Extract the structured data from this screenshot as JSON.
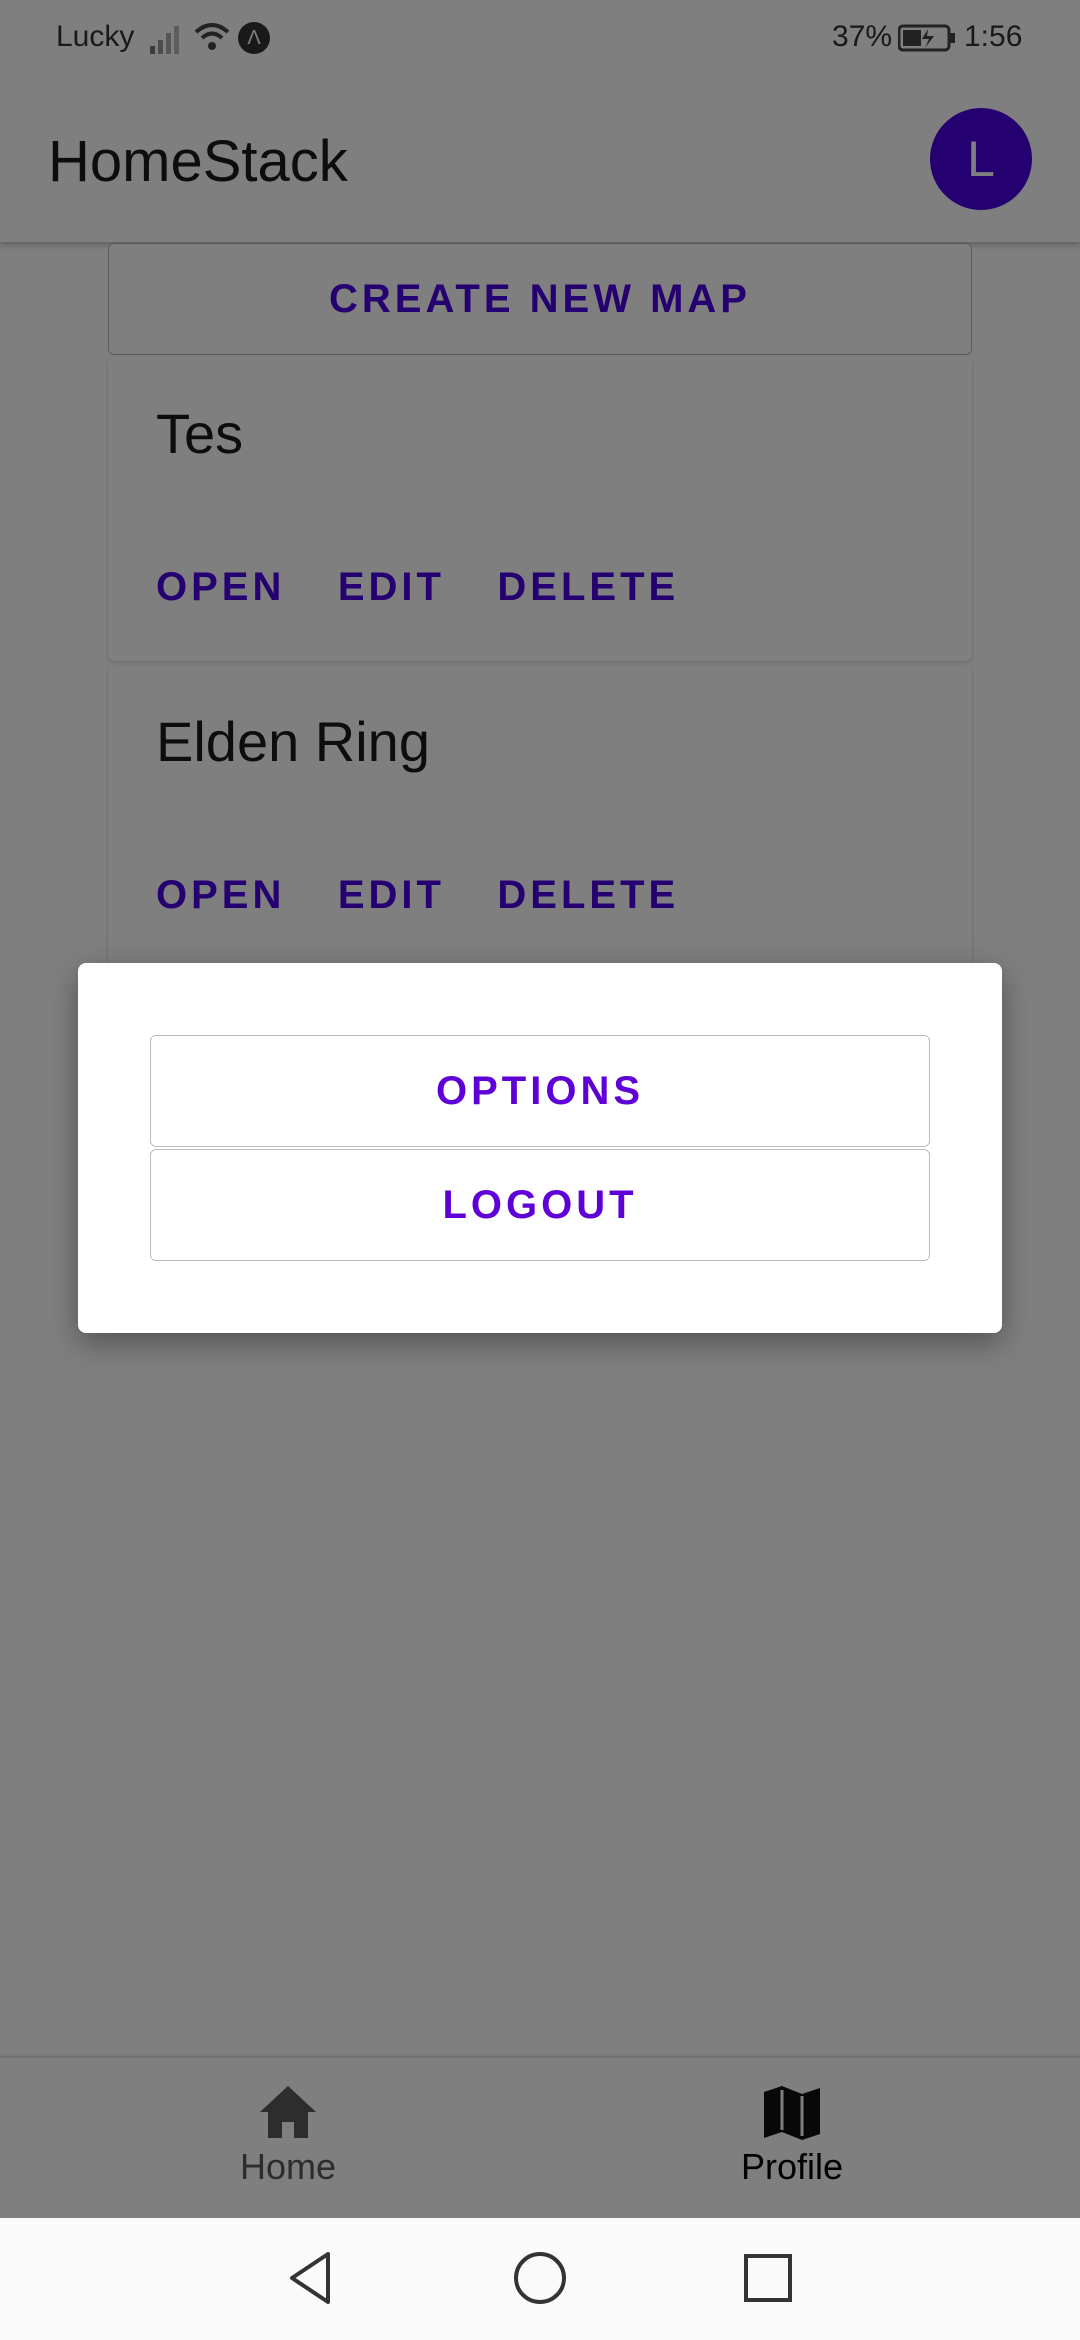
{
  "status_bar": {
    "carrier": "Lucky",
    "battery_percent": "37%",
    "time": "1:56",
    "app_indicator": "Λ"
  },
  "app_bar": {
    "title": "HomeStack",
    "avatar_letter": "L"
  },
  "content": {
    "create_button": "CREATE NEW MAP",
    "maps": [
      {
        "title": "Tes",
        "open": "OPEN",
        "edit": "EDIT",
        "delete": "DELETE"
      },
      {
        "title": "Elden Ring",
        "open": "OPEN",
        "edit": "EDIT",
        "delete": "DELETE"
      }
    ]
  },
  "dialog": {
    "options_label": "OPTIONS",
    "logout_label": "LOGOUT"
  },
  "bottom_nav": {
    "items": [
      {
        "label": "Home",
        "icon": "home-icon"
      },
      {
        "label": "Profile",
        "icon": "map-icon",
        "active": true
      }
    ]
  },
  "system_nav": {
    "icons": [
      "back-icon",
      "home-circle-icon",
      "recents-icon"
    ]
  },
  "colors": {
    "accent": "#4a00e0",
    "dialog_accent": "#5e00d6",
    "scrim": "rgba(0,0,0,0.5)"
  }
}
